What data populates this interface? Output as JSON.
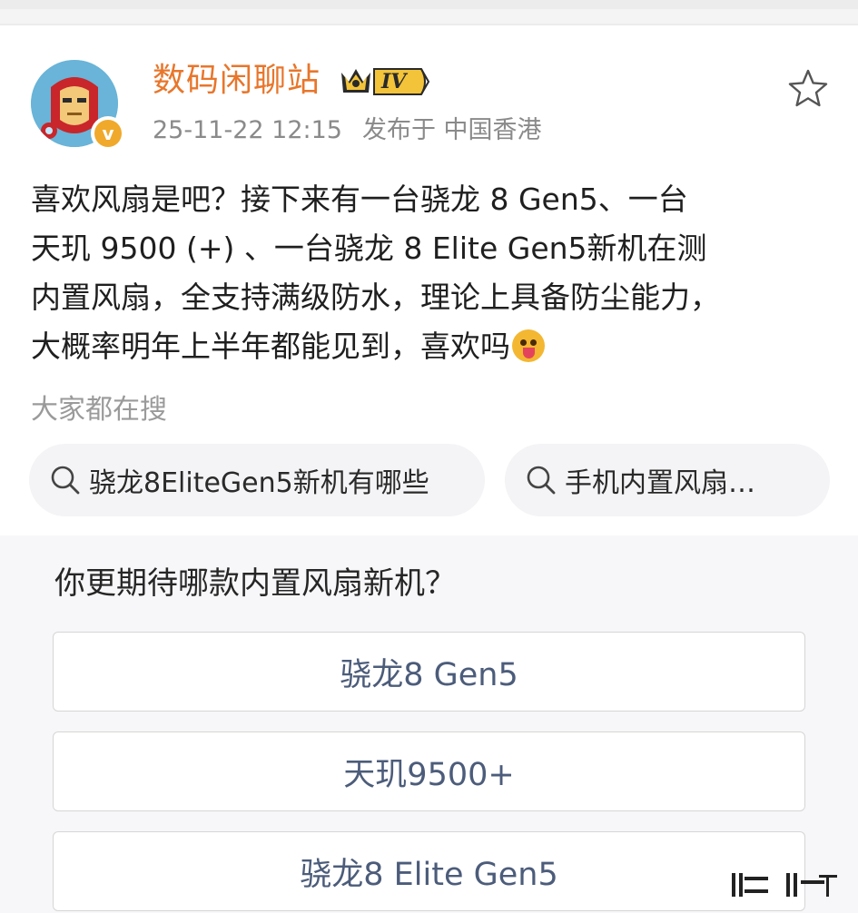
{
  "post": {
    "username": "数码闲聊站",
    "level_badge": "IV",
    "timestamp": "25-11-22 12:15",
    "location": "发布于 中国香港",
    "body_lines": [
      "喜欢风扇是吧？接下来有一台骁龙 8 Gen5、一台",
      "天玑 9500 (+) 、一台骁龙 8 Elite Gen5新机在测",
      "内置风扇，全支持满级防水，理论上具备防尘能力，",
      "大概率明年上半年都能见到，喜欢吗"
    ]
  },
  "search": {
    "label": "大家都在搜",
    "chips": [
      "骁龙8EliteGen5新机有哪些",
      "手机内置风扇…"
    ]
  },
  "poll": {
    "question": "你更期待哪款内置风扇新机？",
    "options": [
      "骁龙8 Gen5",
      "天玑9500+",
      "骁龙8 Elite Gen5"
    ]
  },
  "colors": {
    "username": "#e8762b",
    "meta": "#8a8a8a",
    "poll_option_text": "#4c5c7a",
    "badge_gold": "#f0a92b"
  },
  "icons": [
    "avatar-ironman",
    "verified-icon",
    "crown-level-icon",
    "star-icon",
    "search-icon",
    "emoji-tongue-icon"
  ]
}
